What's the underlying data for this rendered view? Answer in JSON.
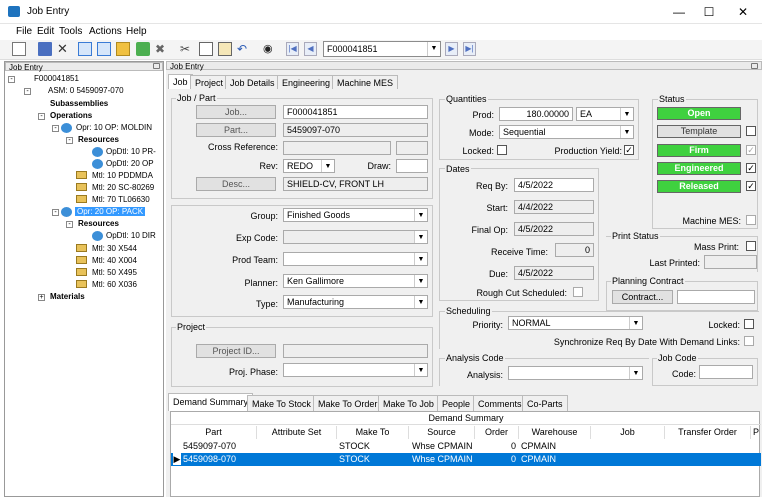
{
  "window": {
    "title": "Job Entry"
  },
  "menu": [
    "File",
    "Edit",
    "Tools",
    "Actions",
    "Help"
  ],
  "toolbar": {
    "job_combo": "F000041851"
  },
  "tree": {
    "header": "Job Entry",
    "root": "F000041851",
    "asm": "ASM: 0 5459097-070",
    "subassemblies": "Subassemblies",
    "operations": "Operations",
    "op10": "Opr: 10 OP: MOLDIN",
    "resources1": "Resources",
    "opdtl_10pr": "OpDtl: 10 PR-",
    "opdtl_20op": "OpDtl: 20 OP",
    "mtl10": "Mtl: 10 PDDMDA",
    "mtl20": "Mtl: 20 SC-80269",
    "mtl70": "Mtl: 70 TL06630",
    "op20": "Opr: 20 OP: PACK",
    "resources2": "Resources",
    "opdtl_10dir": "OpDtl: 10 DIR",
    "mtl30": "Mtl: 30 X544",
    "mtl40": "Mtl: 40 X004",
    "mtl50": "Mtl: 50 X495",
    "mtl60": "Mtl: 60 X036",
    "materials": "Materials"
  },
  "main": {
    "header": "Job Entry",
    "tabs": [
      "Job",
      "Project",
      "Job Details",
      "Engineering",
      "Machine MES"
    ],
    "jobpart": {
      "legend": "Job / Part",
      "job_btn": "Job...",
      "job_val": "F000041851",
      "part_btn": "Part...",
      "part_val": "5459097-070",
      "xref_lbl": "Cross Reference:",
      "rev_lbl": "Rev:",
      "rev_val": "REDO",
      "draw_lbl": "Draw:",
      "desc_btn": "Desc...",
      "desc_val": "SHIELD-CV, FRONT LH"
    },
    "group": {
      "group_lbl": "Group:",
      "group_val": "Finished Goods",
      "exp_lbl": "Exp Code:",
      "team_lbl": "Prod Team:",
      "planner_lbl": "Planner:",
      "planner_val": "Ken Gallimore",
      "type_lbl": "Type:",
      "type_val": "Manufacturing"
    },
    "project": {
      "legend": "Project",
      "btn": "Project ID...",
      "phase_lbl": "Proj. Phase:"
    },
    "quantities": {
      "legend": "Quantities",
      "prod_lbl": "Prod:",
      "prod_val": "180.00000",
      "uom": "EA",
      "mode_lbl": "Mode:",
      "mode_val": "Sequential",
      "locked_lbl": "Locked:",
      "yield_lbl": "Production Yield:"
    },
    "dates": {
      "legend": "Dates",
      "reqby_lbl": "Req By:",
      "reqby": "4/5/2022",
      "start_lbl": "Start:",
      "start": "4/4/2022",
      "finalop_lbl": "Final Op:",
      "finalop": "4/5/2022",
      "recv_lbl": "Receive Time:",
      "recv": "0",
      "due_lbl": "Due:",
      "due": "4/5/2022",
      "rough_lbl": "Rough Cut Scheduled:"
    },
    "status": {
      "legend": "Status",
      "open": "Open",
      "template": "Template",
      "firm": "Firm",
      "engineered": "Engineered",
      "released": "Released",
      "mes_lbl": "Machine MES:"
    },
    "printstatus": {
      "legend": "Print Status",
      "mass_lbl": "Mass Print:",
      "last_lbl": "Last Printed:"
    },
    "planning": {
      "legend": "Planning Contract",
      "btn": "Contract..."
    },
    "scheduling": {
      "legend": "Scheduling",
      "priority_lbl": "Priority:",
      "priority_val": "NORMAL",
      "locked_lbl": "Locked:",
      "sync_lbl": "Synchronize Req By Date With Demand Links:"
    },
    "analysis": {
      "legend": "Analysis Code",
      "lbl": "Analysis:"
    },
    "jobcode": {
      "legend": "Job Code",
      "lbl": "Code:"
    },
    "bottom_tabs": [
      "Demand Summary",
      "Make To Stock",
      "Make To Order",
      "Make To Job",
      "People",
      "Comments",
      "Co-Parts"
    ],
    "grid": {
      "caption": "Demand Summary",
      "headers": [
        "Part",
        "Attribute Set",
        "Make To",
        "Source",
        "Order",
        "Warehouse",
        "Job",
        "Transfer Order",
        "P"
      ],
      "rows": [
        {
          "part": "5459097-070",
          "attr": "",
          "make": "STOCK",
          "source": "Whse CPMAIN",
          "order": "0",
          "wh": "CPMAIN"
        },
        {
          "part": "5459098-070",
          "attr": "",
          "make": "STOCK",
          "source": "Whse CPMAIN",
          "order": "0",
          "wh": "CPMAIN"
        }
      ]
    }
  }
}
